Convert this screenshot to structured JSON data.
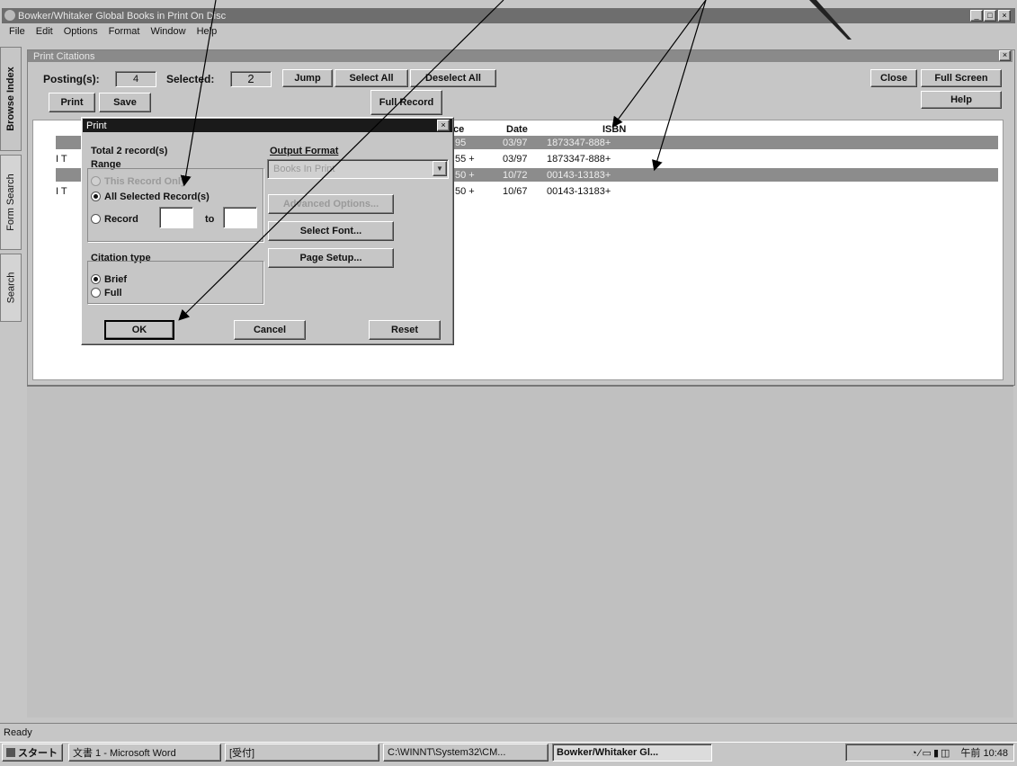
{
  "app": {
    "title": "Bowker/Whitaker Global Books in Print On Disc",
    "menu": [
      "File",
      "Edit",
      "Options",
      "Format",
      "Window",
      "Help"
    ]
  },
  "side_tabs": [
    "Browse Index",
    "Form Search",
    "Search"
  ],
  "citations": {
    "title": "Print Citations",
    "postings_label": "Posting(s):",
    "postings_value": "4",
    "selected_label": "Selected:",
    "selected_value": "2",
    "buttons": {
      "jump": "Jump",
      "select_all": "Select All",
      "deselect_all": "Deselect All",
      "close": "Close",
      "full_screen": "Full Screen",
      "help": "Help",
      "print": "Print",
      "save": "Save",
      "full_record": "Full Record"
    },
    "columns": {
      "price": "ce",
      "date": "Date",
      "isbn": "ISBN"
    },
    "rows": [
      {
        "prefix": "",
        "price": "95",
        "date": "03/97",
        "isbn": "1873347-888+"
      },
      {
        "prefix": "I T",
        "price": "55 +",
        "date": "03/97",
        "isbn": "1873347-888+"
      },
      {
        "prefix": "",
        "price": "50 +",
        "date": "10/72",
        "isbn": "00143-13183+"
      },
      {
        "prefix": "I T",
        "price": "50 +",
        "date": "10/67",
        "isbn": "00143-13183+"
      }
    ]
  },
  "dialog": {
    "title": "Print",
    "total": "Total 2 record(s)",
    "range_label": "Range",
    "range_options": [
      "This Record Only",
      "All Selected Record(s)",
      "Record"
    ],
    "to_label": "to",
    "citation_type_label": "Citation type",
    "citation_options": [
      "Brief",
      "Full"
    ],
    "output_format_label": "Output Format",
    "output_format_value": "Books In Print",
    "buttons": {
      "advanced": "Advanced Options...",
      "select_font": "Select Font...",
      "page_setup": "Page Setup...",
      "ok": "OK",
      "cancel": "Cancel",
      "reset": "Reset"
    }
  },
  "status": "Ready",
  "taskbar": {
    "start": "スタート",
    "items": [
      "文書 1 - Microsoft Word",
      "[受付]",
      "C:\\WINNT\\System32\\CM...",
      "Bowker/Whitaker Gl..."
    ],
    "clock": "午前 10:48"
  }
}
